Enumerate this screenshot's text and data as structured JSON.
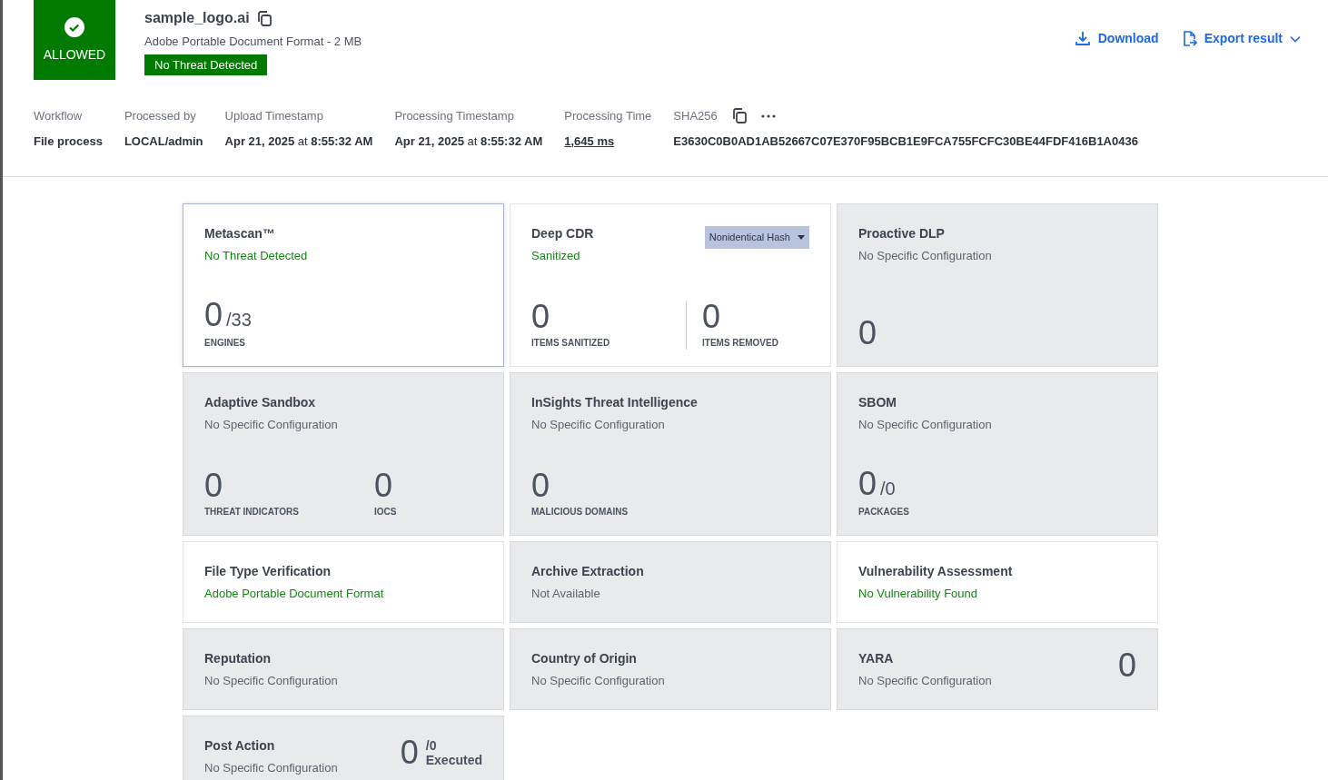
{
  "verdict": {
    "label": "ALLOWED",
    "allowed": true
  },
  "file": {
    "name": "sample_logo.ai",
    "description": "Adobe Portable Document Format - 2 MB",
    "badge": "No Threat Detected"
  },
  "actions": [
    {
      "label": "Download",
      "kind": "download",
      "dropdown": false
    },
    {
      "label": "Export result",
      "kind": "export",
      "dropdown": true
    }
  ],
  "details": [
    {
      "label": "Workflow",
      "value": "File process",
      "kind": "plain"
    },
    {
      "label": "Processed by",
      "value": "LOCAL/admin",
      "kind": "plain"
    },
    {
      "label": "Upload Timestamp",
      "date": "Apr 21, 2025",
      "at": "at",
      "time": "8:55:32 AM",
      "kind": "timestamp"
    },
    {
      "label": "Processing Timestamp",
      "date": "Apr 21, 2025",
      "at": "at",
      "time": "8:55:32 AM",
      "kind": "timestamp"
    },
    {
      "label": "Processing Time",
      "value": "1,645 ms",
      "kind": "link"
    },
    {
      "label": "SHA256",
      "value": "E3630C0B0AD1AB52667C07E370F95BCB1E9FCA755FCFC30BE44FDF416B1A0436",
      "kind": "hash"
    }
  ],
  "cards": [
    {
      "title": "Metascan™",
      "status": "No Threat Detected",
      "enabled": true,
      "selected": true,
      "kind": "tall",
      "metrics": [
        {
          "value": "0",
          "total": "/33",
          "label": "ENGINES"
        }
      ]
    },
    {
      "title": "Deep CDR",
      "status": "Sanitized",
      "enabled": true,
      "selected": false,
      "kind": "tall",
      "dropdown": "Nonidentical Hash",
      "metrics": [
        {
          "value": "0",
          "label": "ITEMS SANITIZED"
        },
        {
          "value": "0",
          "label": "ITEMS REMOVED"
        }
      ]
    },
    {
      "title": "Proactive DLP",
      "status": "No Specific Configuration",
      "enabled": false,
      "selected": false,
      "kind": "tall",
      "metrics": [
        {
          "value": "0"
        }
      ]
    },
    {
      "title": "Adaptive Sandbox",
      "status": "No Specific Configuration",
      "enabled": false,
      "selected": false,
      "kind": "tall",
      "metrics": [
        {
          "value": "0",
          "label": "THREAT INDICATORS"
        },
        {
          "value": "0",
          "label": "IOCS"
        }
      ]
    },
    {
      "title": "InSights Threat Intelligence",
      "status": "No Specific Configuration",
      "enabled": false,
      "selected": false,
      "kind": "tall",
      "metrics": [
        {
          "value": "0",
          "label": "MALICIOUS DOMAINS"
        }
      ]
    },
    {
      "title": "SBOM",
      "status": "No Specific Configuration",
      "enabled": false,
      "selected": false,
      "kind": "tall",
      "metrics": [
        {
          "value": "0",
          "total": "/0",
          "label": "PACKAGES"
        }
      ]
    },
    {
      "title": "File Type Verification",
      "status": "Adobe Portable Document Format",
      "enabled": true,
      "selected": false,
      "kind": "short"
    },
    {
      "title": "Archive Extraction",
      "status": "Not Available",
      "enabled": false,
      "selected": false,
      "kind": "short"
    },
    {
      "title": "Vulnerability Assessment",
      "status": "No Vulnerability Found",
      "enabled": true,
      "selected": false,
      "kind": "short"
    },
    {
      "title": "Reputation",
      "status": "No Specific Configuration",
      "enabled": false,
      "selected": false,
      "kind": "short"
    },
    {
      "title": "Country of Origin",
      "status": "No Specific Configuration",
      "enabled": false,
      "selected": false,
      "kind": "short"
    },
    {
      "title": "YARA",
      "status": "No Specific Configuration",
      "enabled": false,
      "selected": false,
      "kind": "short_count",
      "count": "0"
    },
    {
      "title": "Post Action",
      "status": "No Specific Configuration",
      "enabled": false,
      "selected": false,
      "kind": "short_count",
      "count": "0",
      "total": "/0",
      "count_label": "Executed"
    }
  ]
}
